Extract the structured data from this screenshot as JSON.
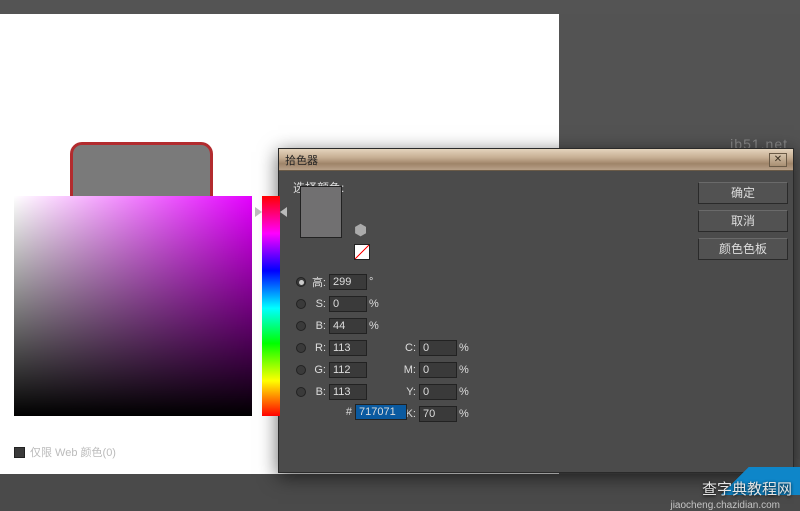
{
  "dialog": {
    "title": "拾色器",
    "label_select": "选择颜色:"
  },
  "buttons": {
    "ok": "确定",
    "cancel": "取消",
    "swatch": "颜色色板"
  },
  "hsb": {
    "h_label": "高:",
    "h_val": "299",
    "h_unit": "°",
    "s_label": "S:",
    "s_val": "0",
    "s_unit": "%",
    "b_label": "B:",
    "b_val": "44",
    "b_unit": "%"
  },
  "rgb": {
    "r_label": "R:",
    "r_val": "113",
    "g_label": "G:",
    "g_val": "112",
    "b2_label": "B:",
    "b2_val": "113"
  },
  "cmyk": {
    "c_label": "C:",
    "c_val": "0",
    "c_unit": "%",
    "m_label": "M:",
    "m_val": "0",
    "m_unit": "%",
    "y_label": "Y:",
    "y_val": "0",
    "y_unit": "%",
    "k_label": "K:",
    "k_val": "70",
    "k_unit": "%"
  },
  "hex": {
    "label": "#",
    "val": "717071"
  },
  "web_only": {
    "label": "仅限 Web 颜色(0)"
  },
  "watermark": {
    "top": "jb51.net",
    "bottom": "查字典教程网",
    "url": "jiaocheng.chazidian.com"
  },
  "colors": {
    "current": "#717071"
  }
}
